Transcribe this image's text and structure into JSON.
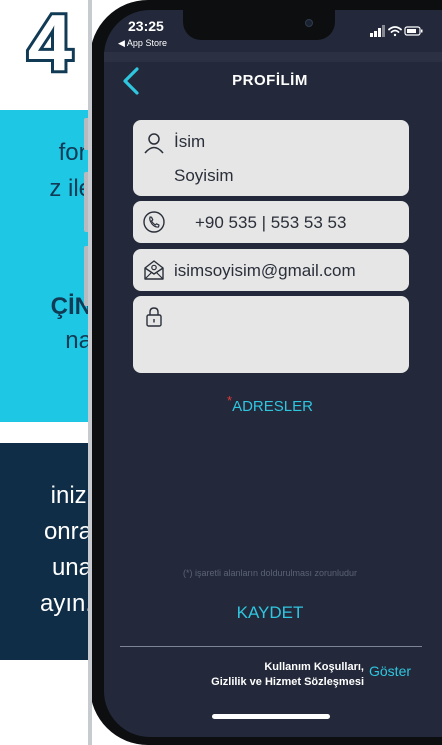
{
  "promo": {
    "step_number": "4",
    "cyan_lines": [
      "fon",
      "z ile",
      "",
      "ÇİN",
      "na"
    ],
    "navy_lines": [
      "inizi",
      "onra",
      "una",
      "ayın."
    ]
  },
  "status_bar": {
    "time": "23:25",
    "back_app": "◀ App Store"
  },
  "header": {
    "title": "PROFİLİM"
  },
  "form": {
    "first_name": "İsim",
    "last_name": "Soyisim",
    "phone": "+90  535 | 553 53 53",
    "email": "isimsoyisim@gmail.com",
    "password": ""
  },
  "address_link": {
    "required_mark": "*",
    "label": "ADRESLER"
  },
  "required_note": "(*) işaretli alanların doldurulması zorunludur",
  "save_button": "KAYDET",
  "footer": {
    "terms_line1": "Kullanım Koşulları,",
    "terms_line2": "Gizlilik ve Hizmet Sözleşmesi",
    "show_link": "Göster"
  },
  "colors": {
    "accent": "#2fc6e0",
    "screen_bg": "#23293a",
    "field_bg": "#e6e6e6",
    "required": "#e23a3a",
    "promo_cyan": "#1ec8e4",
    "promo_navy": "#0f2d47"
  },
  "icons": [
    "back-chevron-icon",
    "user-icon",
    "phone-icon",
    "mail-icon",
    "lock-icon",
    "signal-icon",
    "wifi-icon",
    "battery-icon"
  ]
}
